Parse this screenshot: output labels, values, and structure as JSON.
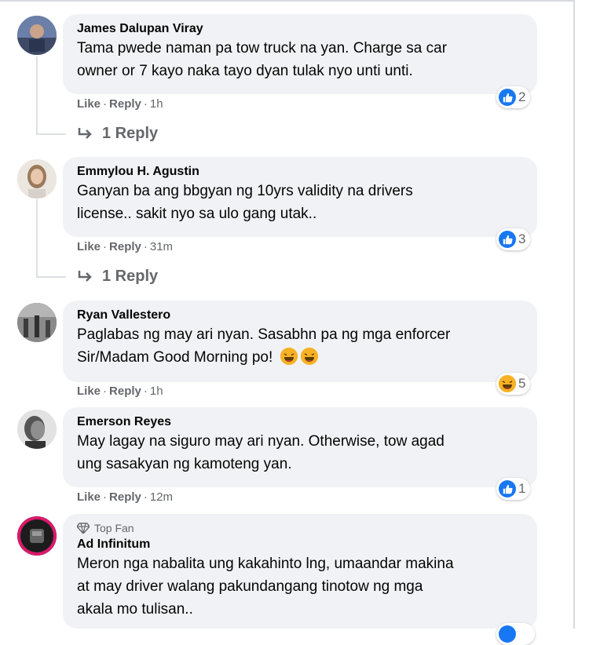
{
  "comments": [
    {
      "name": "James Dalupan Viray",
      "lines": [
        "Tama pwede naman pa tow truck na yan. Charge sa car",
        "owner or 7 kayo naka tayo dyan tulak nyo unti unti."
      ],
      "like": "Like",
      "reply": "Reply",
      "time": "1h",
      "reaction_count": "2",
      "reaction_type": "like-icon",
      "replies_label": "1 Reply"
    },
    {
      "name": "Emmylou H. Agustin",
      "lines": [
        "Ganyan ba ang bbgyan ng 10yrs validity na drivers",
        "license.. sakit nyo sa ulo gang utak.."
      ],
      "like": "Like",
      "reply": "Reply",
      "time": "31m",
      "reaction_count": "3",
      "reaction_type": "like-icon",
      "replies_label": "1 Reply"
    },
    {
      "name": "Ryan Vallestero",
      "lines": [
        "Paglabas ng may ari nyan. Sasabhn pa ng mga enforcer",
        "Sir/Madam Good Morning po!"
      ],
      "like": "Like",
      "reply": "Reply",
      "time": "1h",
      "reaction_count": "5",
      "reaction_type": "haha-icon"
    },
    {
      "name": "Emerson Reyes",
      "lines": [
        "May lagay na siguro may ari nyan. Otherwise, tow agad",
        "ung sasakyan ng kamoteng yan."
      ],
      "like": "Like",
      "reply": "Reply",
      "time": "12m",
      "reaction_count": "1",
      "reaction_type": "like-icon"
    },
    {
      "badge": "Top Fan",
      "name": "Ad Infinitum",
      "lines": [
        "Meron nga nabalita ung kakahinto lng, umaandar makina",
        "at may driver walang pakundangang tinotow ng mga",
        "akala mo tulisan.."
      ]
    }
  ],
  "colors": {
    "like_blue": "#1877f2",
    "haha_yellow": "#f7b125",
    "bubble": "#f0f2f5",
    "meta_gray": "#65676b"
  }
}
